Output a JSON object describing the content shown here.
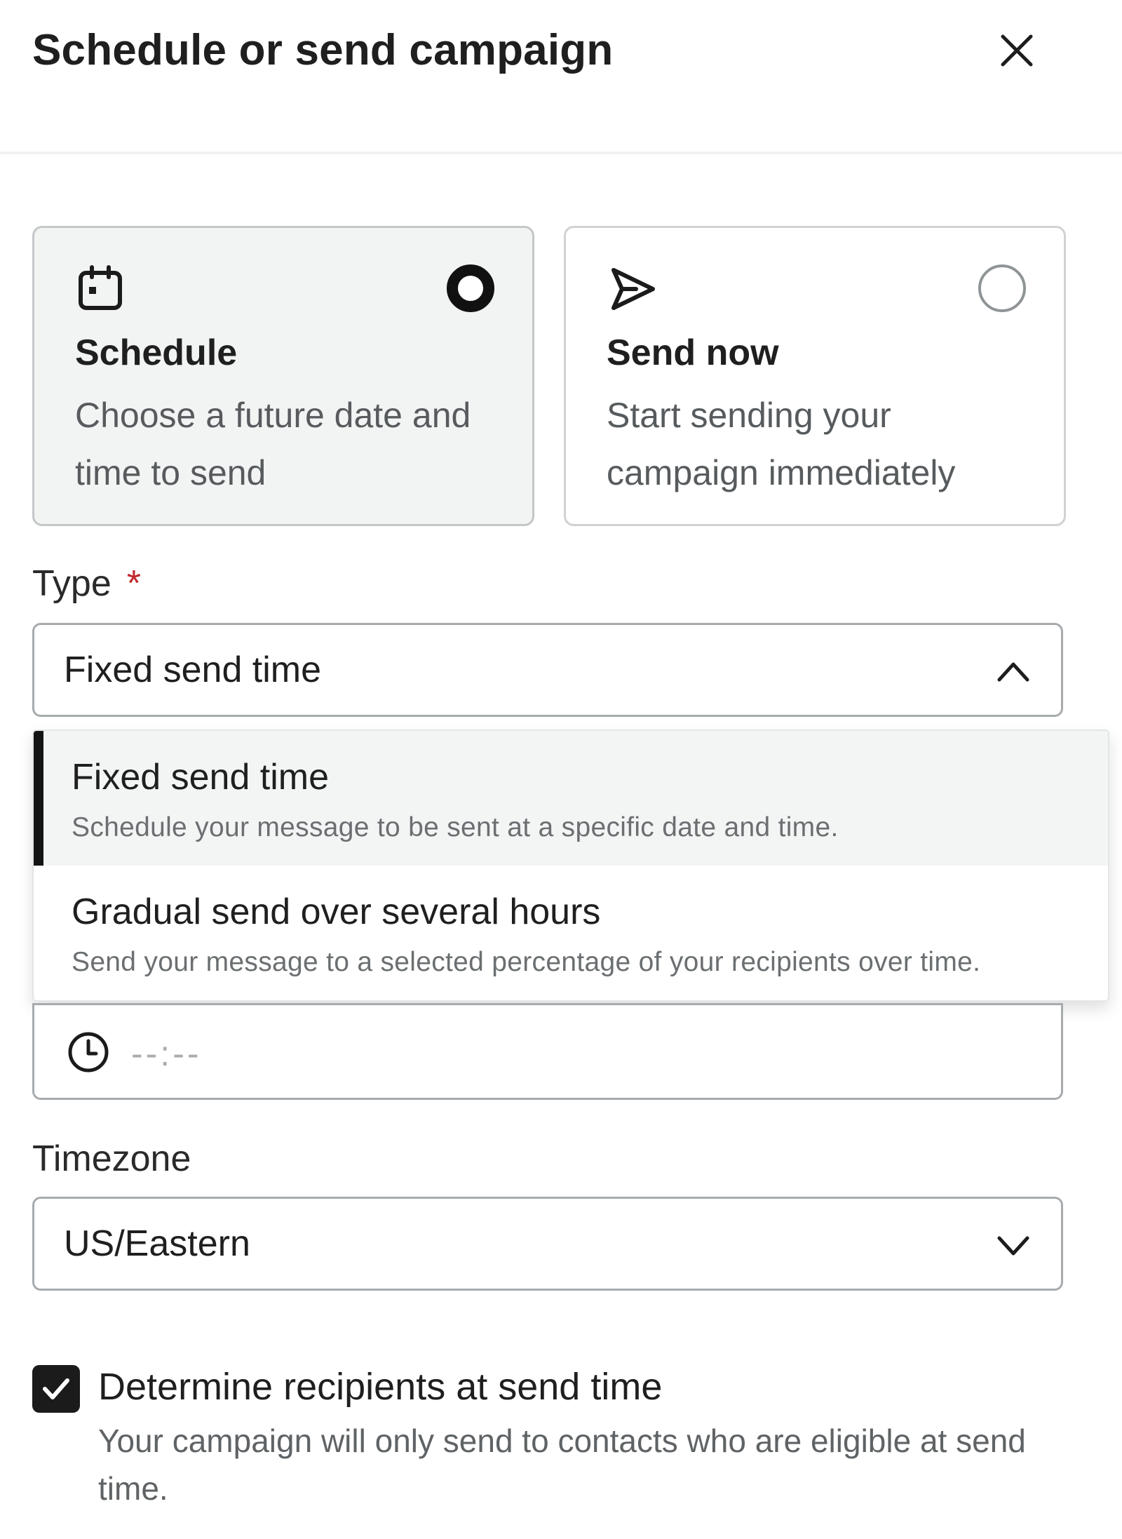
{
  "dialog": {
    "title": "Schedule or send campaign",
    "close_icon": "close-icon"
  },
  "options": {
    "schedule": {
      "icon": "calendar-icon",
      "title": "Schedule",
      "description": "Choose a future date and time to send",
      "selected": true
    },
    "send_now": {
      "icon": "send-icon",
      "title": "Send now",
      "description": "Start sending your campaign immediately",
      "selected": false
    }
  },
  "type_field": {
    "label": "Type",
    "required_marker": "*",
    "value": "Fixed send time",
    "expanded": true,
    "menu": [
      {
        "title": "Fixed send time",
        "description": "Schedule your message to be sent at a specific date and time.",
        "selected": true
      },
      {
        "title": "Gradual send over several hours",
        "description": "Send your message to a selected percentage of your recipients over time.",
        "selected": false
      }
    ]
  },
  "time_field": {
    "icon": "clock-icon",
    "placeholder": "--:--"
  },
  "timezone_field": {
    "label": "Timezone",
    "value": "US/Eastern"
  },
  "determine_recipients": {
    "checked": true,
    "label": "Determine recipients at send time",
    "description": "Your campaign will only send to contacts who are eligible at send time."
  },
  "colors": {
    "selected_card_bg": "#f2f4f4",
    "required": "#c2262e",
    "checkbox": "#1b1b1b"
  }
}
